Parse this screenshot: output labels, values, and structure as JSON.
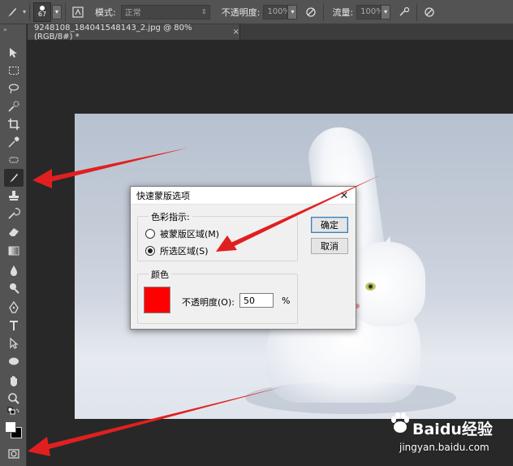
{
  "options_bar": {
    "brush_size": "67",
    "mode_label": "模式:",
    "mode_value": "正常",
    "opacity_label": "不透明度:",
    "opacity_value": "100%",
    "flow_label": "流量:",
    "flow_value": "100%"
  },
  "document": {
    "tab_title": "9248108_184041548143_2.jpg @ 80%(RGB/8#) *",
    "close_glyph": "×"
  },
  "dialog": {
    "title": "快速蒙版选项",
    "close_glyph": "✕",
    "color_indicates": {
      "label": "色彩指示:",
      "options": [
        {
          "label": "被蒙版区域(M)",
          "selected": false
        },
        {
          "label": "所选区域(S)",
          "selected": true
        }
      ]
    },
    "color_group": {
      "label": "颜色",
      "swatch_color": "#ff0000",
      "opacity_label": "不透明度(O):",
      "opacity_value": "50",
      "opacity_unit": "%"
    },
    "ok_label": "确定",
    "cancel_label": "取消"
  },
  "watermark": {
    "brand": "Baidu经验",
    "url": "jingyan.baidu.com"
  },
  "colors": {
    "arrow": "#e02020",
    "panel": "#535353",
    "workspace": "#282828"
  }
}
